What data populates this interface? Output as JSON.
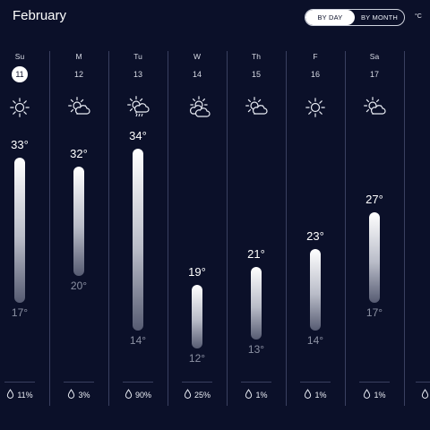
{
  "header": {
    "title": "February",
    "toggle": {
      "by_day": "BY DAY",
      "by_month": "BY MONTH",
      "active": "by_day"
    },
    "unit": "°C"
  },
  "days": [
    {
      "dow": "Su",
      "date": "11",
      "today": true,
      "icon": "sun-icon",
      "high": "33°",
      "low": "17°",
      "rain": "11%",
      "high_value": 33,
      "low_value": 17
    },
    {
      "dow": "M",
      "date": "12",
      "today": false,
      "icon": "sun-cloud-icon",
      "high": "32°",
      "low": "20°",
      "rain": "3%",
      "high_value": 32,
      "low_value": 20
    },
    {
      "dow": "Tu",
      "date": "13",
      "today": false,
      "icon": "sun-cloud-rain-icon",
      "high": "34°",
      "low": "14°",
      "rain": "90%",
      "high_value": 34,
      "low_value": 14
    },
    {
      "dow": "W",
      "date": "14",
      "today": false,
      "icon": "sun-clouds-icon",
      "high": "19°",
      "low": "12°",
      "rain": "25%",
      "high_value": 19,
      "low_value": 12
    },
    {
      "dow": "Th",
      "date": "15",
      "today": false,
      "icon": "sun-cloud-icon",
      "high": "21°",
      "low": "13°",
      "rain": "1%",
      "high_value": 21,
      "low_value": 13
    },
    {
      "dow": "F",
      "date": "16",
      "today": false,
      "icon": "sun-icon",
      "high": "23°",
      "low": "14°",
      "rain": "1%",
      "high_value": 23,
      "low_value": 14
    },
    {
      "dow": "Sa",
      "date": "17",
      "today": false,
      "icon": "sun-cloud-icon",
      "high": "27°",
      "low": "17°",
      "rain": "1%",
      "high_value": 27,
      "low_value": 17
    }
  ]
}
